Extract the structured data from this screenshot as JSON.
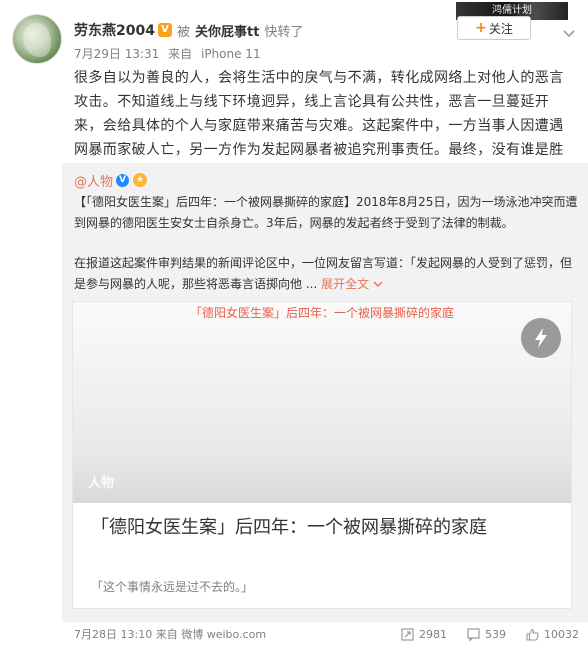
{
  "header": {
    "username": "劳东燕2004",
    "vip_badge": "V",
    "mid_text": "被",
    "repost_user": "关你屁事tt",
    "repost_verb": "快转了",
    "date": "7月29日 13:31",
    "source_prefix": "来自",
    "source": "iPhone 11",
    "follow_label": "关注",
    "banner_text": "鸿儒计划"
  },
  "post": {
    "content": "很多自以为善良的人，会将生活中的戾气与不满，转化成网络上对他人的恶言攻击。不知道线上与线下环境迥异，线上言论具有公共性，恶言一旦蔓延开来，会给具体的个人与家庭带来痛苦与灾难。这起案件中，一方当事人因遭遇网暴而家破人亡，另一方作为发起网暴者被追究刑事责任。最终，没有谁是胜利者。"
  },
  "repost": {
    "author": "@人物",
    "para1": "【「德阳女医生案」后四年：一个被网暴撕碎的家庭】2018年8月25日，因为一场泳池冲突而遭到网暴的德阳医生安女士自杀身亡。3年后，网暴的发起者终于受到了法律的制裁。",
    "para2": "在报道这起案件审判结果的新闻评论区中，一位网友留言写道：「发起网暴的人受到了惩罚，但是参与网暴的人呢，那些将恶毒言语掷向他 ...",
    "expand_label": "展开全文",
    "card": {
      "media_title": "「德阳女医生案」后四年：一个被网暴撕碎的家庭",
      "source_label": "人物",
      "title": "「德阳女医生案」后四年：一个被网暴撕碎的家庭",
      "description": "「这个事情永远是过不去的。」"
    }
  },
  "footer": {
    "time": "7月28日 13:10",
    "source_prefix": "来自",
    "source": "微博 weibo.com",
    "reposts": "2981",
    "comments": "539",
    "likes": "10032"
  },
  "colors": {
    "accent": "#eb7350",
    "follow_plus": "#ff8200",
    "repost_bg": "#f2f2f5"
  },
  "icons": [
    "chevron-down-icon",
    "lightning-icon",
    "repost-icon",
    "comment-icon",
    "like-icon",
    "verified-icon",
    "medal-icon"
  ]
}
